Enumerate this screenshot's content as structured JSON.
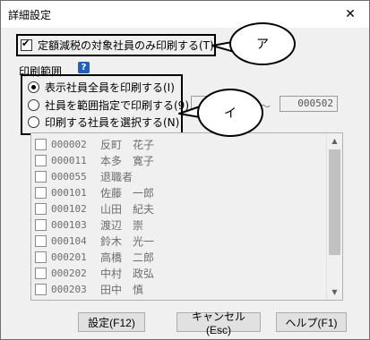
{
  "window": {
    "title": "詳細設定",
    "close_label": "✕"
  },
  "options": {
    "reduced_tax_only_label": "定額減税の対象社員のみ印刷する(T)",
    "reduced_tax_only_checked": true
  },
  "print_range": {
    "group_label": "印刷範囲",
    "help_label": "?",
    "radios": [
      {
        "label": "表示社員全員を印刷する(I)",
        "selected": true
      },
      {
        "label": "社員を範囲指定で印刷する(9)",
        "selected": false
      },
      {
        "label": "印刷する社員を選択する(N)",
        "selected": false
      }
    ],
    "range_from": "",
    "range_separator": "～",
    "range_to": "000502"
  },
  "employees": [
    {
      "code": "000002",
      "name": "反町　花子"
    },
    {
      "code": "000011",
      "name": "本多　寛子"
    },
    {
      "code": "000055",
      "name": "退職者"
    },
    {
      "code": "000101",
      "name": "佐藤　一郎"
    },
    {
      "code": "000102",
      "name": "山田　紀夫"
    },
    {
      "code": "000103",
      "name": "渡辺　崇"
    },
    {
      "code": "000104",
      "name": "鈴木　光一"
    },
    {
      "code": "000201",
      "name": "高橋　二郎"
    },
    {
      "code": "000202",
      "name": "中村　政弘"
    },
    {
      "code": "000203",
      "name": "田中　慎"
    }
  ],
  "buttons": {
    "settings": "設定(F12)",
    "cancel": "キャンセル(Esc)",
    "help": "ヘルプ(F1)"
  },
  "callouts": {
    "a": "ア",
    "i": "イ"
  }
}
